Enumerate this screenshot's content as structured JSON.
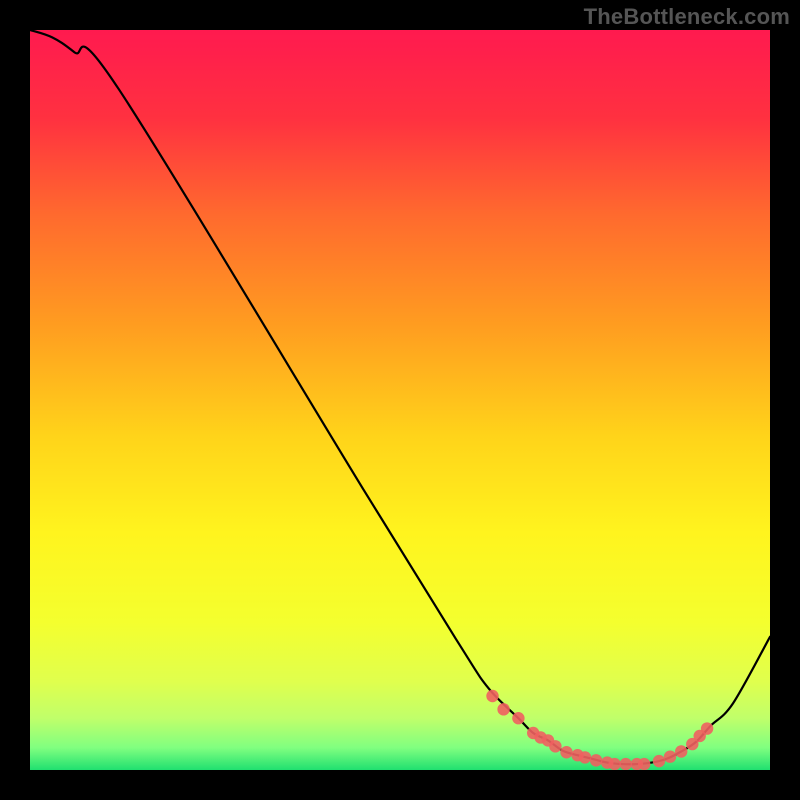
{
  "watermark": "TheBottleneck.com",
  "colors": {
    "frame": "#000000",
    "curve": "#000000",
    "marker": "#f06060",
    "gradient_stops": [
      {
        "o": 0.0,
        "c": "#ff1a4f"
      },
      {
        "o": 0.12,
        "c": "#ff3140"
      },
      {
        "o": 0.25,
        "c": "#ff6a2e"
      },
      {
        "o": 0.4,
        "c": "#ff9d20"
      },
      {
        "o": 0.55,
        "c": "#ffd41a"
      },
      {
        "o": 0.68,
        "c": "#fff41e"
      },
      {
        "o": 0.8,
        "c": "#f4ff2e"
      },
      {
        "o": 0.88,
        "c": "#e0ff4d"
      },
      {
        "o": 0.93,
        "c": "#c0ff6a"
      },
      {
        "o": 0.97,
        "c": "#80ff80"
      },
      {
        "o": 1.0,
        "c": "#20e070"
      }
    ]
  },
  "chart_data": {
    "type": "line",
    "title": "",
    "xlabel": "",
    "ylabel": "",
    "xlim": [
      0,
      100
    ],
    "ylim": [
      0,
      100
    ],
    "grid": false,
    "series": [
      {
        "name": "curve",
        "x": [
          0,
          3,
          6,
          12,
          45,
          58,
          62,
          66,
          68,
          70,
          72,
          74,
          76,
          78,
          80,
          82,
          84,
          86,
          88,
          90,
          92,
          95,
          100
        ],
        "y": [
          100,
          99,
          97,
          92,
          38,
          17,
          11,
          7,
          5,
          4,
          2.6,
          2,
          1.5,
          1,
          0.8,
          0.8,
          1,
          1.5,
          2.5,
          3.8,
          6,
          9,
          18
        ]
      }
    ],
    "markers": {
      "name": "highlight",
      "x": [
        62.5,
        64,
        66,
        68,
        69,
        70,
        71,
        72.5,
        74,
        75,
        76.5,
        78,
        79,
        80.5,
        82,
        83,
        85,
        86.5,
        88,
        89.5,
        90.5,
        91.5
      ],
      "y": [
        10.0,
        8.2,
        7.0,
        5.0,
        4.4,
        4.0,
        3.2,
        2.4,
        2.0,
        1.7,
        1.3,
        1.0,
        0.8,
        0.8,
        0.8,
        0.8,
        1.2,
        1.8,
        2.5,
        3.5,
        4.6,
        5.6
      ]
    }
  }
}
